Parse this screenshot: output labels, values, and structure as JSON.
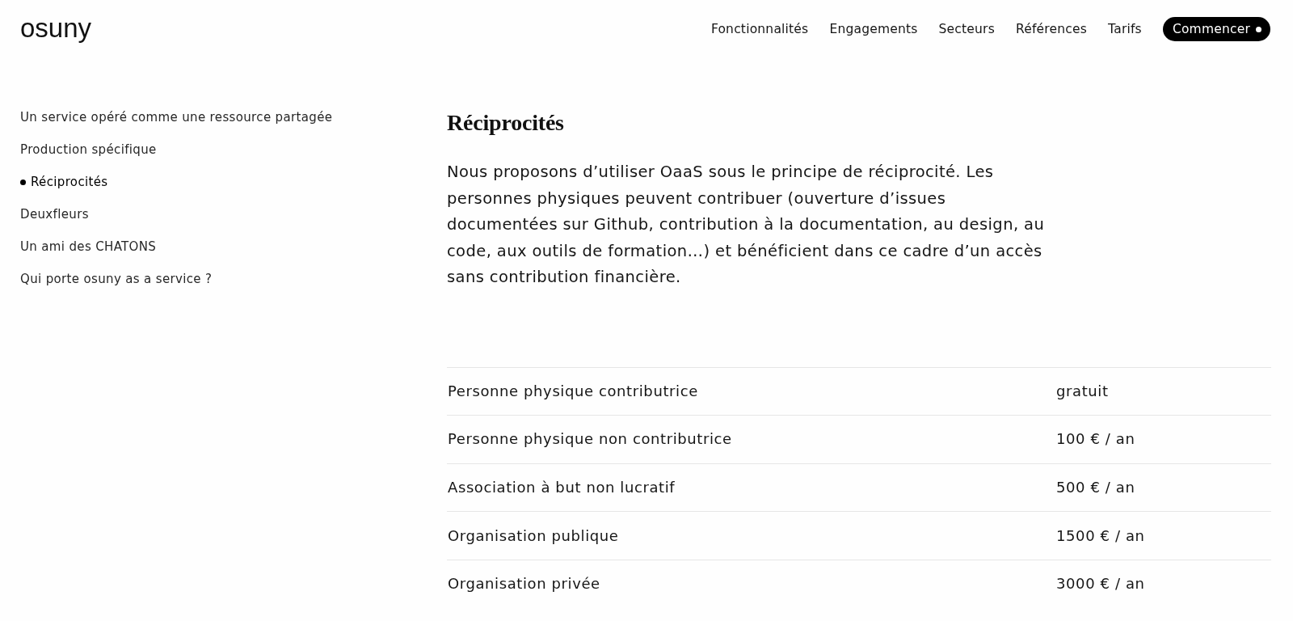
{
  "header": {
    "logo": "osuny",
    "nav": [
      "Fonctionnalités",
      "Engagements",
      "Secteurs",
      "Références",
      "Tarifs"
    ],
    "cta": "Commencer"
  },
  "sidebar": {
    "items": [
      {
        "label": "Un service opéré comme une ressource partagée",
        "selected": false
      },
      {
        "label": "Production spécifique",
        "selected": false
      },
      {
        "label": "Réciprocités",
        "selected": true
      },
      {
        "label": "Deuxfleurs",
        "selected": false
      },
      {
        "label": "Un ami des CHATONS",
        "selected": false
      },
      {
        "label": "Qui porte osuny as a service ?",
        "selected": false
      }
    ]
  },
  "content": {
    "title": "Réciprocités",
    "paragraph": "Nous proposons d’utiliser OaaS sous le principe de réciprocité. Les personnes physiques peuvent contribuer (ouverture d’issues documentées sur Github, contribution à la documentation, au design, au code, aux outils de formation…) et bénéficient dans ce cadre d’un accès sans contribution financière.",
    "pricing_table": {
      "rows": [
        {
          "label": "Personne physique contributrice",
          "price": "gratuit"
        },
        {
          "label": "Personne physique non contributrice",
          "price": "100 € / an"
        },
        {
          "label": "Association à but non lucratif",
          "price": "500 € / an"
        },
        {
          "label": "Organisation publique",
          "price": "1500 € / an"
        },
        {
          "label": "Organisation privée",
          "price": "3000 € / an"
        }
      ]
    }
  }
}
